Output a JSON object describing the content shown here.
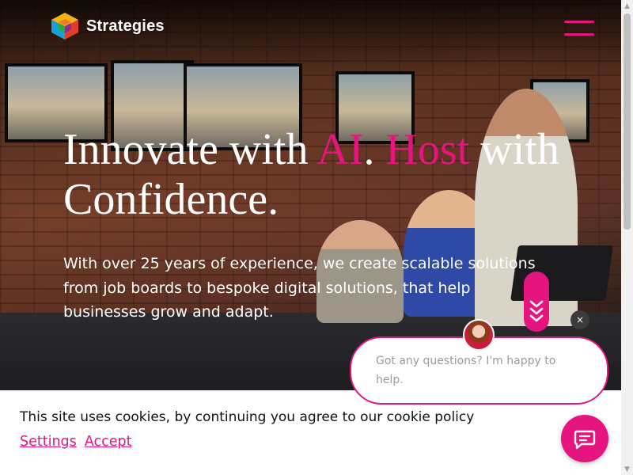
{
  "header": {
    "logo_text": "Strategies",
    "logo_icon": "strategies-cube-logo",
    "menu_icon": "hamburger-menu-icon"
  },
  "hero": {
    "headline_part1": "Innovate with ",
    "headline_ai": "AI",
    "headline_part2": ". ",
    "headline_host": "Host",
    "headline_part3": " with Confidence.",
    "subtext": "With over 25 years of experience, we create scalable solutions from job boards to bespoke digital solutions, that help businesses grow and adapt.",
    "scroll_icon": "chevrons-down-icon"
  },
  "cookie_bar": {
    "message": "This site uses cookies, by continuing you agree to our cookie policy",
    "settings_label": "Settings",
    "accept_label": "Accept"
  },
  "chat": {
    "message": "Got any questions? I'm happy to help.",
    "close_label": "×",
    "launcher_icon": "chat-bubble-icon"
  },
  "colors": {
    "accent": "#e6147f",
    "text_light": "#ffffff",
    "cookie_bg": "#ffffff"
  }
}
